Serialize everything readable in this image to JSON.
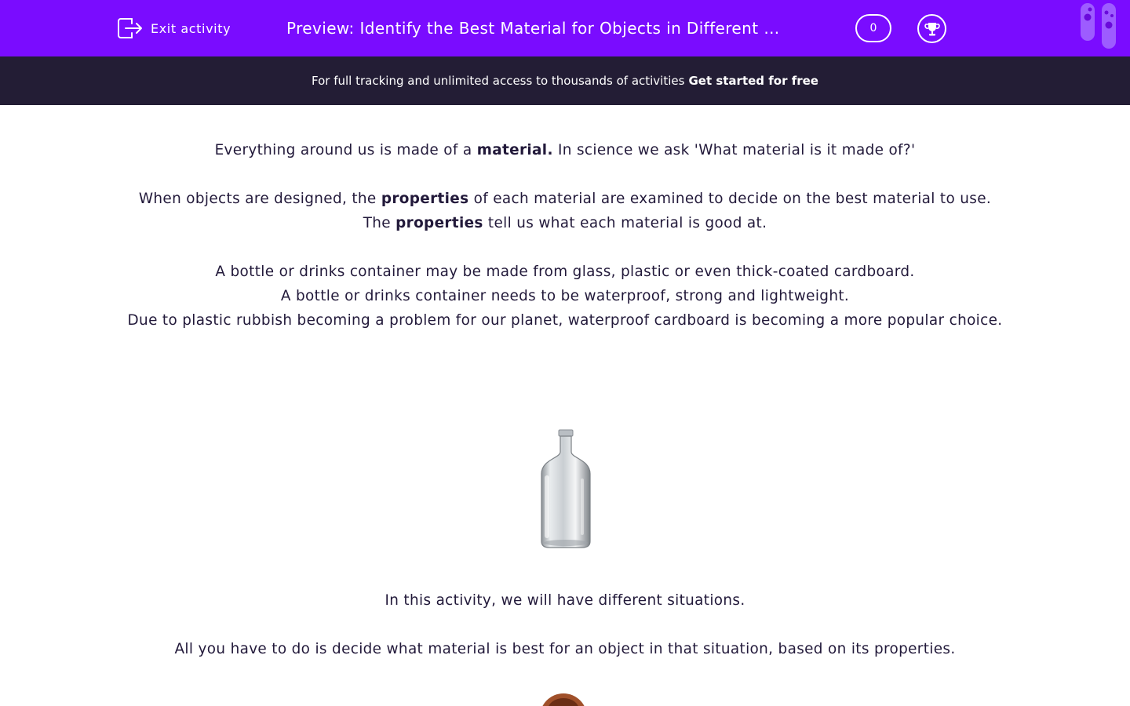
{
  "header": {
    "exit_label": "Exit activity",
    "title": "Preview: Identify the Best Material for Objects in Different …",
    "score": "0",
    "colors": {
      "bar": "#7a0cff",
      "text": "#ffffff"
    },
    "icons": {
      "exit": "exit-icon",
      "trophy": "trophy-icon",
      "logo": "test-tubes-logo-icon"
    }
  },
  "banner": {
    "text": "For full tracking and unlimited access to thousands of activities",
    "cta": "Get started for free"
  },
  "intro": {
    "p1_a": "Everything around us is made of a ",
    "p1_bold": "material.",
    "p1_b": "  In science we ask 'What material is it made of?'",
    "p2_a": "When objects are designed, the ",
    "p2_bold": "properties",
    "p2_b": " of each material are examined to decide on the best material to use.",
    "p3_a": "The ",
    "p3_bold": "properties",
    "p3_b": " tell us what each material is good at.",
    "p4": "A bottle or drinks container may be made from glass, plastic or even thick-coated cardboard.",
    "p5": "A bottle or drinks container needs to be waterproof, strong and lightweight.",
    "p6": "Due to plastic rubbish becoming a problem for our planet, waterproof cardboard is becoming a more popular choice."
  },
  "image": {
    "icon": "glass-bottle-icon"
  },
  "instructions": {
    "p1": "In this activity, we will have different situations.",
    "p2": "All you have to do is decide what material is best for an object in that situation, based on its properties."
  },
  "avatar": {
    "icon": "teacher-avatar-icon"
  }
}
